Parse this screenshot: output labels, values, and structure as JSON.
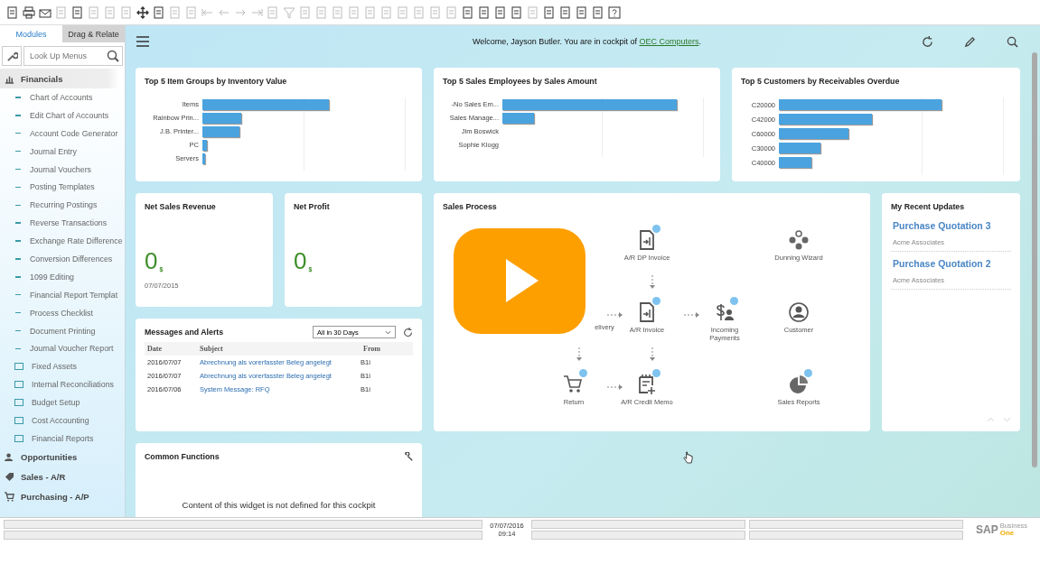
{
  "toolbar": [
    {
      "disabled": false
    },
    {
      "disabled": false
    },
    {
      "disabled": false
    },
    {
      "disabled": true
    },
    {
      "disabled": false
    },
    {
      "disabled": true
    },
    {
      "disabled": true
    },
    {
      "disabled": true
    },
    {
      "disabled": false
    },
    {
      "disabled": false
    },
    {
      "disabled": true
    },
    {
      "disabled": true
    },
    {
      "disabled": true
    },
    {
      "disabled": true
    },
    {
      "disabled": true
    },
    {
      "disabled": true
    },
    {
      "disabled": true
    },
    {
      "disabled": true
    },
    {
      "disabled": true
    },
    {
      "disabled": true
    },
    {
      "disabled": true
    },
    {
      "disabled": true
    },
    {
      "disabled": true
    },
    {
      "disabled": true
    },
    {
      "disabled": true
    },
    {
      "disabled": true
    },
    {
      "disabled": true
    },
    {
      "disabled": true
    },
    {
      "disabled": false
    },
    {
      "disabled": false
    },
    {
      "disabled": false
    },
    {
      "disabled": false
    },
    {
      "disabled": true
    },
    {
      "disabled": false
    },
    {
      "disabled": false
    },
    {
      "disabled": false
    },
    {
      "disabled": false
    },
    {
      "disabled": false
    }
  ],
  "sidebar": {
    "tabs": [
      {
        "label": "Modules",
        "selected": true
      },
      {
        "label": "Drag & Relate",
        "selected": false
      }
    ],
    "search": {
      "placeholder": "Look Up Menus"
    },
    "modules": [
      {
        "label": "Financials",
        "kind": "finance",
        "expanded": true,
        "selected": true,
        "children": [
          {
            "label": "Chart of Accounts",
            "kind": "item"
          },
          {
            "label": "Edit Chart of Accounts",
            "kind": "item"
          },
          {
            "label": "Account Code Generator",
            "kind": "item"
          },
          {
            "label": "Journal Entry",
            "kind": "item"
          },
          {
            "label": "Journal Vouchers",
            "kind": "item"
          },
          {
            "label": "Posting Templates",
            "kind": "item"
          },
          {
            "label": "Recurring Postings",
            "kind": "item"
          },
          {
            "label": "Reverse Transactions",
            "kind": "item"
          },
          {
            "label": "Exchange Rate Difference",
            "kind": "item"
          },
          {
            "label": "Conversion Differences",
            "kind": "item"
          },
          {
            "label": "1099 Editing",
            "kind": "item"
          },
          {
            "label": "Financial Report Templat",
            "kind": "item"
          },
          {
            "label": "Process Checklist",
            "kind": "item"
          },
          {
            "label": "Document Printing",
            "kind": "item"
          },
          {
            "label": "Journal Voucher Report",
            "kind": "item"
          },
          {
            "label": "Fixed Assets",
            "kind": "folder"
          },
          {
            "label": "Internal Reconciliations",
            "kind": "folder"
          },
          {
            "label": "Budget Setup",
            "kind": "folder"
          },
          {
            "label": "Cost Accounting",
            "kind": "folder"
          },
          {
            "label": "Financial Reports",
            "kind": "folder"
          }
        ]
      },
      {
        "label": "Opportunities",
        "kind": "opportunities",
        "expanded": false,
        "selected": false
      },
      {
        "label": "Sales - A/R",
        "kind": "sales",
        "expanded": false,
        "selected": false
      },
      {
        "label": "Purchasing - A/P",
        "kind": "purchasing",
        "expanded": false,
        "selected": false
      }
    ]
  },
  "header": {
    "welcome_before": "Welcome, Jayson Butler. You are in cockpit of",
    "cockpit_link": "OEC Computers",
    "welcome_after": "."
  },
  "top_charts": [
    {
      "title": "Top 5 Item Groups by Inventory Value",
      "categories": [
        "Items",
        "Rainbow Prin...",
        "J.B. Printer...",
        "PC",
        "Servers"
      ]
    },
    {
      "title": "Top 5 Sales Employees by Sales Amount",
      "categories": [
        "-No Sales Em...",
        "Sales Manage...",
        "Jim Boswick",
        "Sophie Klogg"
      ]
    },
    {
      "title": "Top 5 Customers by Receivables Overdue",
      "categories": [
        "C20000",
        "C42000",
        "C60000",
        "C30000",
        "C40000"
      ]
    }
  ],
  "kpis": [
    {
      "title": "Net Sales Revenue",
      "value": "0",
      "unit": "$",
      "date": "07/07/2015"
    },
    {
      "title": "Net Profit",
      "value": "0",
      "unit": "$"
    }
  ],
  "messages": {
    "title": "Messages and Alerts",
    "filter": "All in 30 Days",
    "columns": [
      "Date",
      "Subject",
      "From"
    ],
    "rows": [
      [
        "2016/07/07",
        "Abrechnung als vorerfasster Beleg angelegt",
        "B1i"
      ],
      [
        "2016/07/07",
        "Abrechnung als vorerfasster Beleg angelegt",
        "B1i"
      ],
      [
        "2016/07/06",
        "System Message: RFQ",
        "B1i"
      ]
    ]
  },
  "common_functions": {
    "title": "Common Functions",
    "message": "Content of this widget is not defined for this cockpit"
  },
  "sales_process": {
    "title": "Sales Process",
    "nodes": [
      {
        "label": "A/R DP Invoice",
        "kind": "dp-invoice",
        "badge": true
      },
      {
        "label": "Dunning Wizard",
        "kind": "dunning",
        "badge": false
      },
      {
        "label": "elivery",
        "kind": "delivery"
      },
      {
        "label": "A/R Invoice",
        "kind": "invoice",
        "badge": true
      },
      {
        "label": "Incoming Payments",
        "kind": "payments",
        "badge": true
      },
      {
        "label": "Customer",
        "kind": "customer",
        "badge": false
      },
      {
        "label": "Return",
        "kind": "return",
        "badge": true
      },
      {
        "label": "A/R Credit Memo",
        "kind": "credit-memo",
        "badge": true
      },
      {
        "label": "Sales Reports",
        "kind": "reports",
        "badge": true
      }
    ]
  },
  "recent_updates": {
    "title": "My Recent Updates",
    "items": [
      {
        "title": "Purchase Quotation 3",
        "subtitle": "Acme Associates"
      },
      {
        "title": "Purchase Quotation 2",
        "subtitle": "Acme Associates"
      }
    ]
  },
  "status_bar": {
    "date": "07/07/2016",
    "time": "09:14",
    "logo": "SAP",
    "logo_sub1": "Business",
    "logo_sub2": "One"
  }
}
